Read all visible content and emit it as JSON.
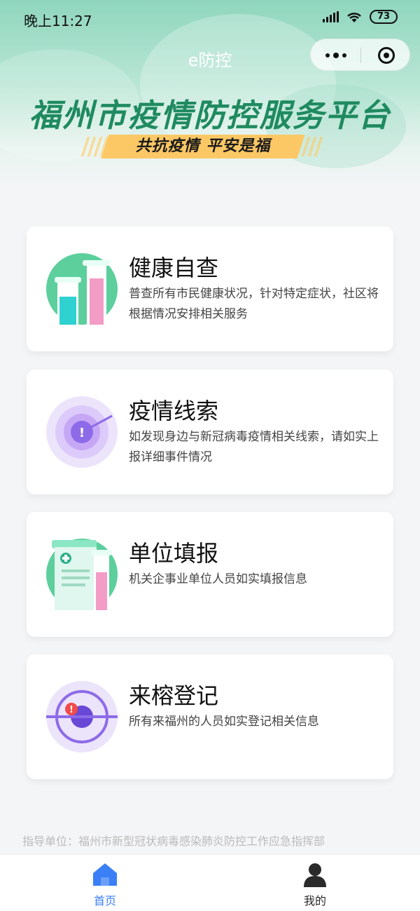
{
  "status_bar": {
    "time": "晚上11:27",
    "battery": "73"
  },
  "nav": {
    "title": "e防控"
  },
  "hero": {
    "title": "福州市疫情防控服务平台",
    "slogan": "共抗疫情  平安是福"
  },
  "cards": [
    {
      "title": "健康自查",
      "desc": "普查所有市民健康状况，针对特定症状，社区将根据情况安排相关服务",
      "icon": "test-tubes-icon"
    },
    {
      "title": "疫情线索",
      "desc": "如发现身边与新冠病毒疫情相关线索，请如实上报详细事件情况",
      "icon": "radar-alert-icon"
    },
    {
      "title": "单位填报",
      "desc": "机关企事业单位人员如实填报信息",
      "icon": "medical-form-icon"
    },
    {
      "title": "来榕登记",
      "desc": "所有来福州的人员如实登记相关信息",
      "icon": "target-alert-icon"
    }
  ],
  "footer": {
    "note": "指导单位：福州市新型冠状病毒感染肺炎防控工作应急指挥部"
  },
  "tabbar": {
    "home": {
      "label": "首页",
      "icon": "home-icon",
      "color": "#3a7ff6"
    },
    "mine": {
      "label": "我的",
      "icon": "user-icon",
      "color": "#2a2a2a"
    }
  },
  "colors": {
    "accent": "#3a7ff6",
    "hero_green": "#1f8a60",
    "slogan_bg": "#fcc865"
  }
}
